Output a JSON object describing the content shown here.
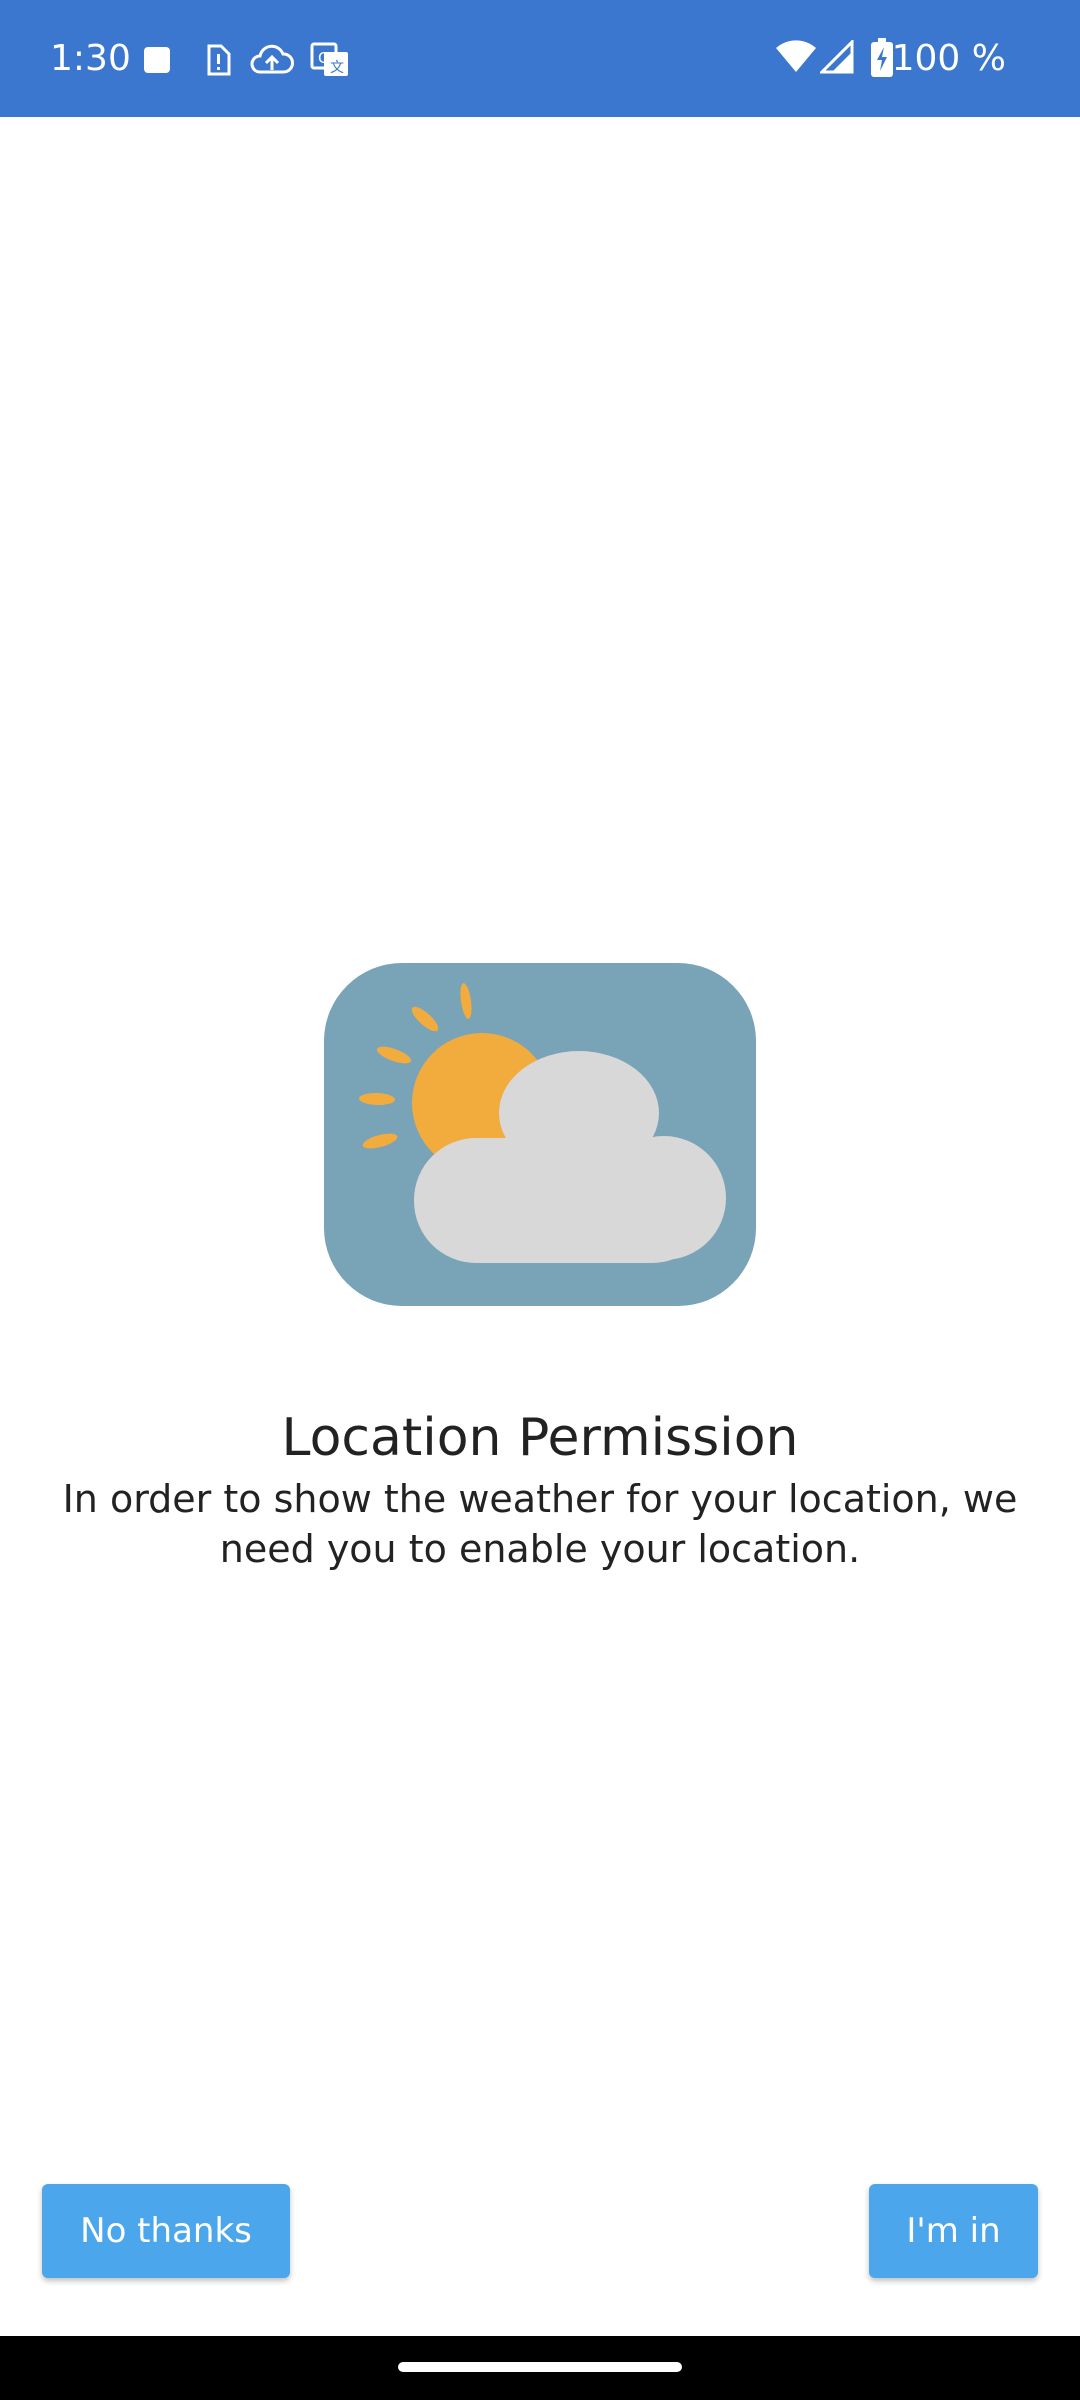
{
  "status_bar": {
    "time": "1:30",
    "battery_text": "100 %",
    "icons": [
      "stop-square-icon",
      "sim-alert-icon",
      "cloud-upload-icon",
      "translate-icon",
      "wifi-icon",
      "cell-signal-icon",
      "battery-charging-icon"
    ]
  },
  "content": {
    "illustration": "weather-partly-cloudy-icon",
    "title": "Location Permission",
    "description": "In order to show the weather for your location, we need you to enable your location."
  },
  "actions": {
    "no_label": "No thanks",
    "yes_label": "I'm in"
  },
  "colors": {
    "status_bar": "#3b76cf",
    "button": "#4ba6ec",
    "icon_background": "#79a3b7",
    "sun": "#f2ac3e",
    "cloud": "#d8d8d8"
  }
}
